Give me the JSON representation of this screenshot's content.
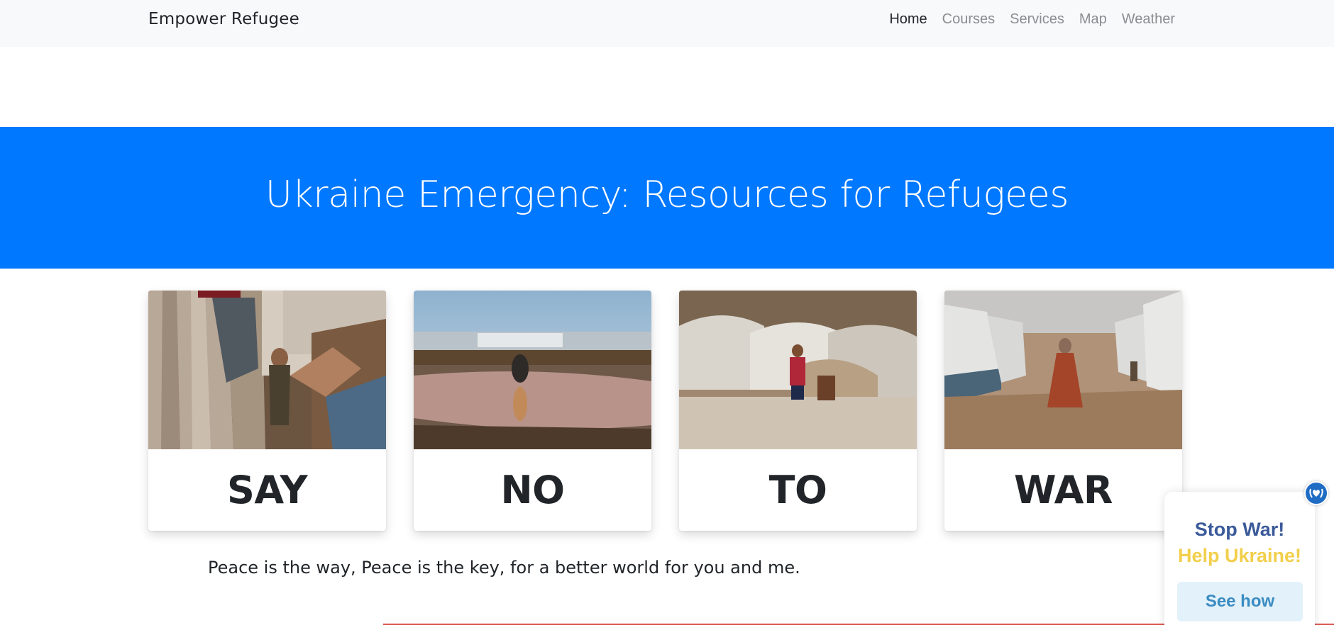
{
  "navbar": {
    "brand": "Empower Refugee",
    "links": [
      {
        "label": "Home",
        "active": true
      },
      {
        "label": "Courses",
        "active": false
      },
      {
        "label": "Services",
        "active": false
      },
      {
        "label": "Map",
        "active": false
      },
      {
        "label": "Weather",
        "active": false
      }
    ]
  },
  "hero": {
    "title": "Ukraine Emergency: Resources for Refugees",
    "color": "#0078ff"
  },
  "cards": [
    {
      "word": "SAY",
      "image": "refugee-child-tent-photo"
    },
    {
      "word": "NO",
      "image": "person-puddle-camp-photo"
    },
    {
      "word": "TO",
      "image": "girl-camp-tents-photo"
    },
    {
      "word": "WAR",
      "image": "woman-walking-camp-photo"
    }
  ],
  "quote": "Peace is the way, Peace is the key, for a better world for you and me.",
  "widget": {
    "line1": "Stop War!",
    "line2": "Help Ukraine!",
    "button": "See how",
    "icon": "heart-hands-icon"
  }
}
